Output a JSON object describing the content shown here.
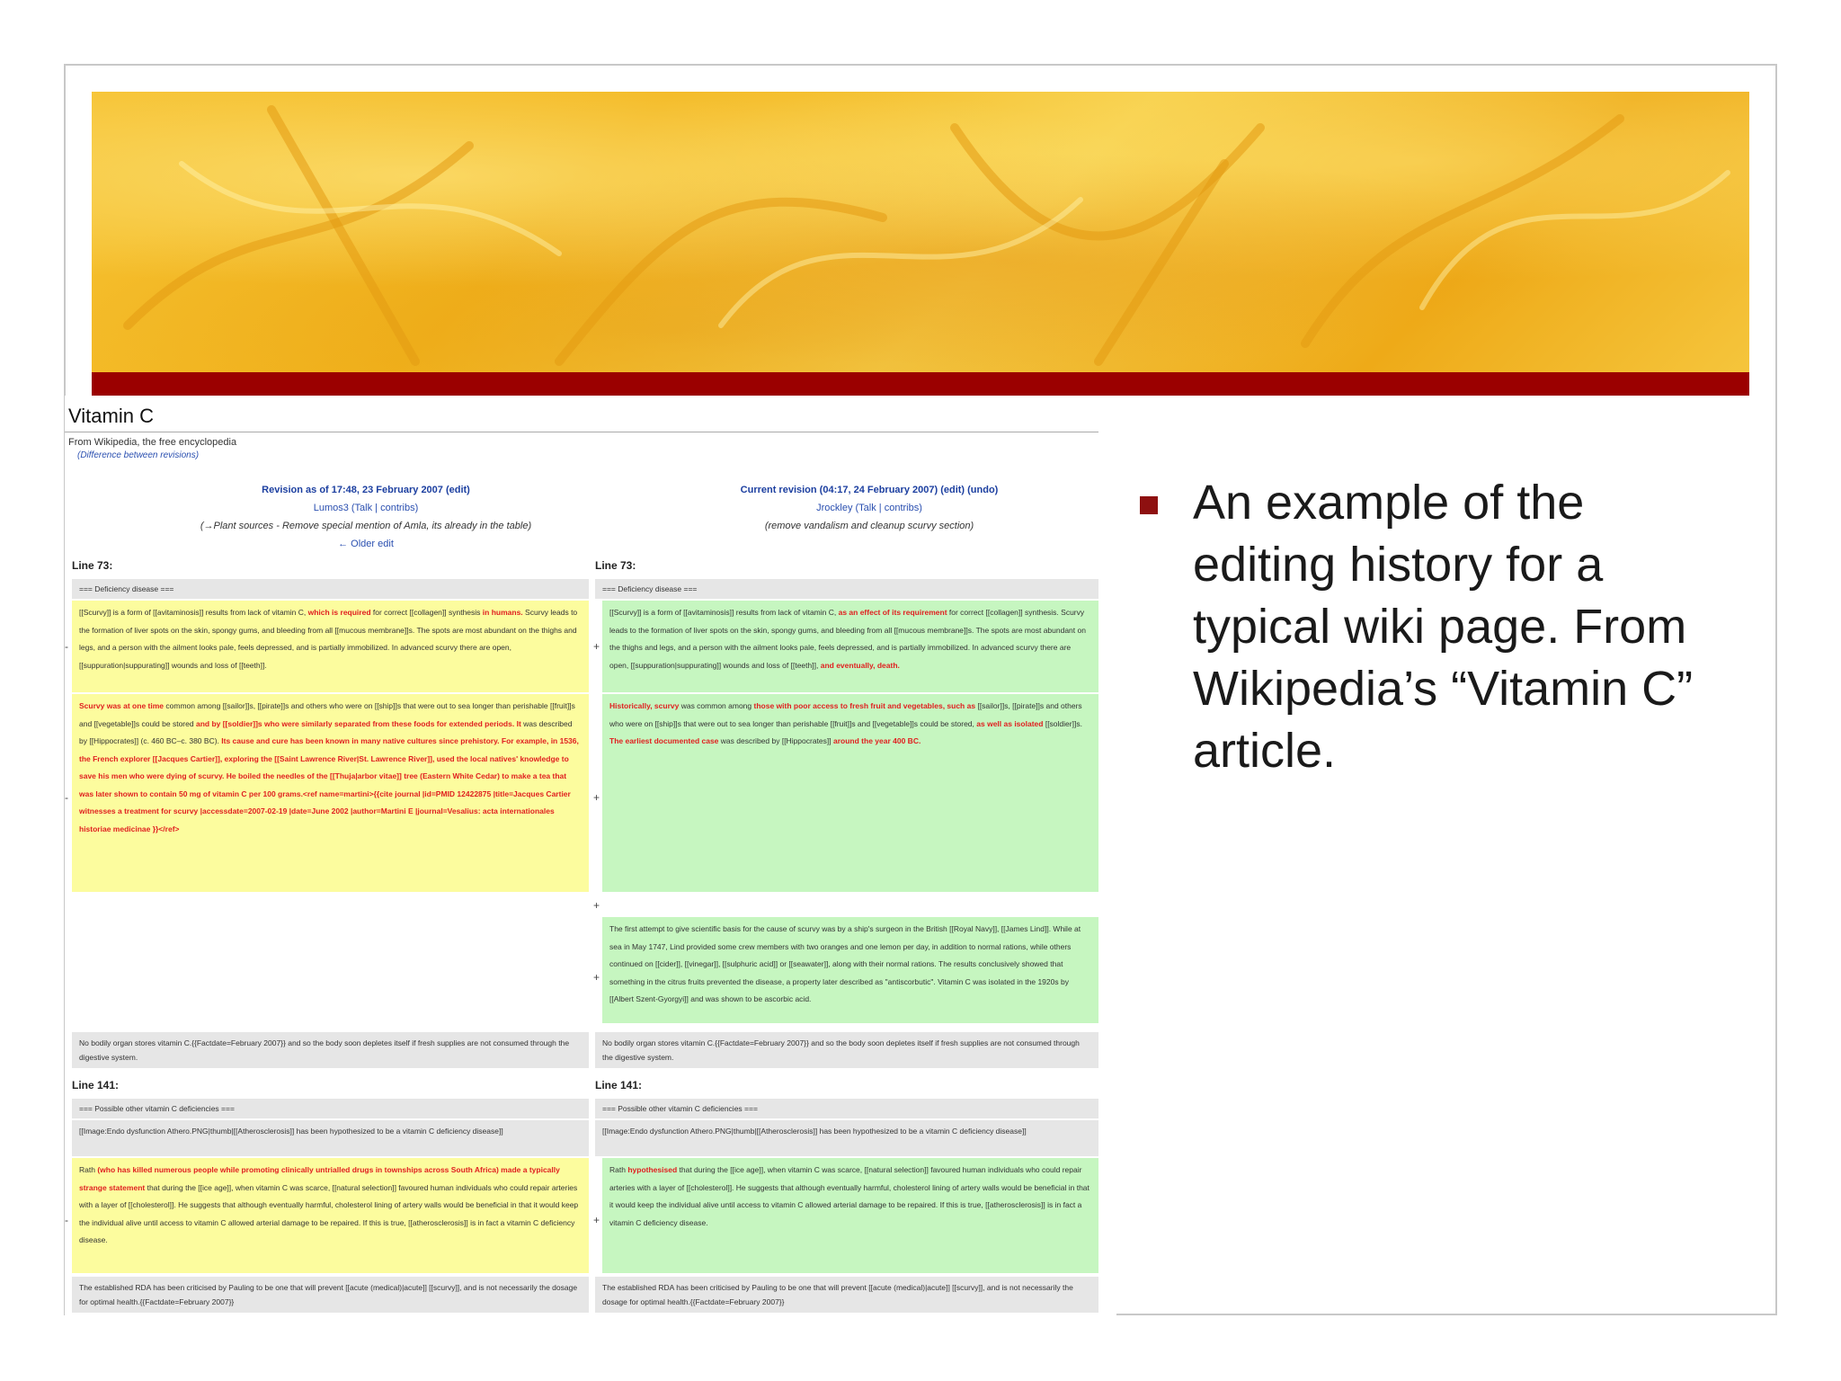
{
  "slide": {
    "bullet": "An example of the editing history for a typical wiki page. From Wikipedia’s “Vitamin C” article."
  },
  "colors": {
    "banner_stripe": "#9b0000",
    "bullet_marker": "#8e1010",
    "deleted": "#fcfc9e",
    "added": "#c6f6c0",
    "removed_text": "#e02020"
  },
  "wiki": {
    "title": "Vitamin C",
    "from": "From Wikipedia, the free encyclopedia",
    "diff_note": "(Difference between revisions)",
    "left_rev": {
      "title": "Revision as of 17:48, 23 February 2007 (edit)",
      "user": "Lumos3 (Talk | contribs)",
      "comment": "(→Plant sources - Remove special mention of Amla, its already in the table)",
      "nav": "← Older edit"
    },
    "right_rev": {
      "title": "Current revision (04:17, 24 February 2007) (edit) (undo)",
      "user": "Jrockley (Talk | contribs)",
      "comment": "(remove vandalism and cleanup scurvy section)"
    },
    "line_73": "Line 73:",
    "line_141": "Line 141:",
    "heading_1": "=== Deficiency disease ===",
    "heading_2": "=== Possible other vitamin C deficiencies ===",
    "left_p1_a": "[[Scurvy]] is a form of [[avitaminosis]] results from lack of vitamin C,",
    "left_p1_red": "which is required",
    "left_p1_b": "for correct [[collagen]] synthesis",
    "left_p1_red2": "in humans.",
    "left_p1_c": "Scurvy leads to the formation of liver spots on the skin, spongy gums, and bleeding from all [[mucous membrane]]s. The spots are most abundant on the thighs and legs, and a person with the ailment looks pale, feels depressed, and is partially immobilized. In advanced scurvy there are open, [[suppuration|suppurating]] wounds and loss of [[teeth]].",
    "left_p2_red": "Scurvy was at one time",
    "left_p2_a": "common among [[sailor]]s, [[pirate]]s and others who were on [[ship]]s that were out to sea longer than perishable [[fruit]]s and [[vegetable]]s could be stored",
    "left_p2_red2": "and by [[soldier]]s who were similarly separated from these foods for extended periods. It",
    "left_p2_b": "was described by [[Hippocrates]] (c. 460 BC–c. 380 BC).",
    "left_p2_red3": "Its cause and cure has been known in many native cultures since prehistory. For example, in 1536, the French explorer [[Jacques Cartier]], exploring the [[Saint Lawrence River|St. Lawrence River]], used the local natives' knowledge to save his men who were dying of scurvy. He boiled the needles of the [[Thuja|arbor vitae]] tree (Eastern White Cedar) to make a tea that was later shown to contain 50 mg of vitamin C per 100 grams.<ref name=martini>{{cite journal |id=PMID 12422875 |title=Jacques Cartier witnesses a treatment for scurvy |accessdate=2007-02-19 |date=June 2002 |author=Martini E |journal=Vesalius: acta internationales historiae medicinae }}</ref>",
    "right_p1_a": "[[Scurvy]] is a form of [[avitaminosis]] results from lack of vitamin C,",
    "right_p1_red": "as an effect of its requirement",
    "right_p1_b": "for correct [[collagen]] synthesis. Scurvy leads to the formation of liver spots on the skin, spongy gums, and bleeding from all [[mucous membrane]]s. The spots are most abundant on the thighs and legs, and a person with the ailment looks pale, feels depressed, and is partially immobilized. In advanced scurvy there are open, [[suppuration|suppurating]] wounds and loss of [[teeth]],",
    "right_p1_red2": "and eventually, death.",
    "right_p2_red": "Historically, scurvy",
    "right_p2_a": "was common among",
    "right_p2_red2": "those with poor access to fresh fruit and vegetables, such as",
    "right_p2_b": "[[sailor]]s, [[pirate]]s and others who were on [[ship]]s that were out to sea longer than perishable [[fruit]]s and [[vegetable]]s could be stored,",
    "right_p2_red3": "as well as isolated",
    "right_p2_c": "[[soldier]]s.",
    "right_p2_red4": "The earliest documented case",
    "right_p2_d": "was described by [[Hippocrates]]",
    "right_p2_red5": "around the year 400 BC.",
    "right_p3": "The first attempt to give scientific basis for the cause of scurvy was by a ship's surgeon in the British [[Royal Navy]], [[James Lind]]. While at sea in May 1747, Lind provided some crew members with two oranges and one lemon per day, in addition to normal rations, while others continued on [[cider]], [[vinegar]], [[sulphuric acid]] or [[seawater]], along with their normal rations. The results conclusively showed that something in the citrus fruits prevented the disease, a property later described as \"antiscorbutic\". Vitamin C was isolated in the 1920s by [[Albert Szent-Gyorgyi]] and was shown to be ascorbic acid.",
    "ctx_body": "No bodily organ stores vitamin C.{{Factdate=February 2007}} and so the body soon depletes itself if fresh supplies are not consumed through the digestive system.",
    "ctx_image": "[[Image:Endo dysfunction Athero.PNG|thumb|[[Atherosclerosis]] has been hypothesized to be a vitamin C deficiency disease]]",
    "left_p4_a": "Rath",
    "left_p4_red": "(who has killed numerous people while promoting clinically untrialled drugs in townships across South Africa) made a typically strange statement",
    "left_p4_b": "that during the [[ice age]], when vitamin C was scarce, [[natural selection]] favoured human individuals who could repair arteries with a layer of [[cholesterol]]. He suggests that although eventually harmful, cholesterol lining of artery walls would be beneficial in that it would keep the individual alive until access to vitamin C allowed arterial damage to be repaired. If this is true, [[atherosclerosis]] is in fact a vitamin C deficiency disease.",
    "right_p4_a": "Rath",
    "right_p4_red": "hypothesised",
    "right_p4_b": "that during the [[ice age]], when vitamin C was scarce, [[natural selection]] favoured human individuals who could repair arteries with a layer of [[cholesterol]]. He suggests that although eventually harmful, cholesterol lining of artery walls would be beneficial in that it would keep the individual alive until access to vitamin C allowed arterial damage to be repaired. If this is true, [[atherosclerosis]] is in fact a vitamin C deficiency disease.",
    "ctx_rda": "The established RDA has been criticised by Pauling to be one that will prevent [[acute (medical)|acute]] [[scurvy]], and is not necessarily the dosage for optimal health.{{Factdate=February 2007}}",
    "mark_minus": "-",
    "mark_plus": "+"
  }
}
